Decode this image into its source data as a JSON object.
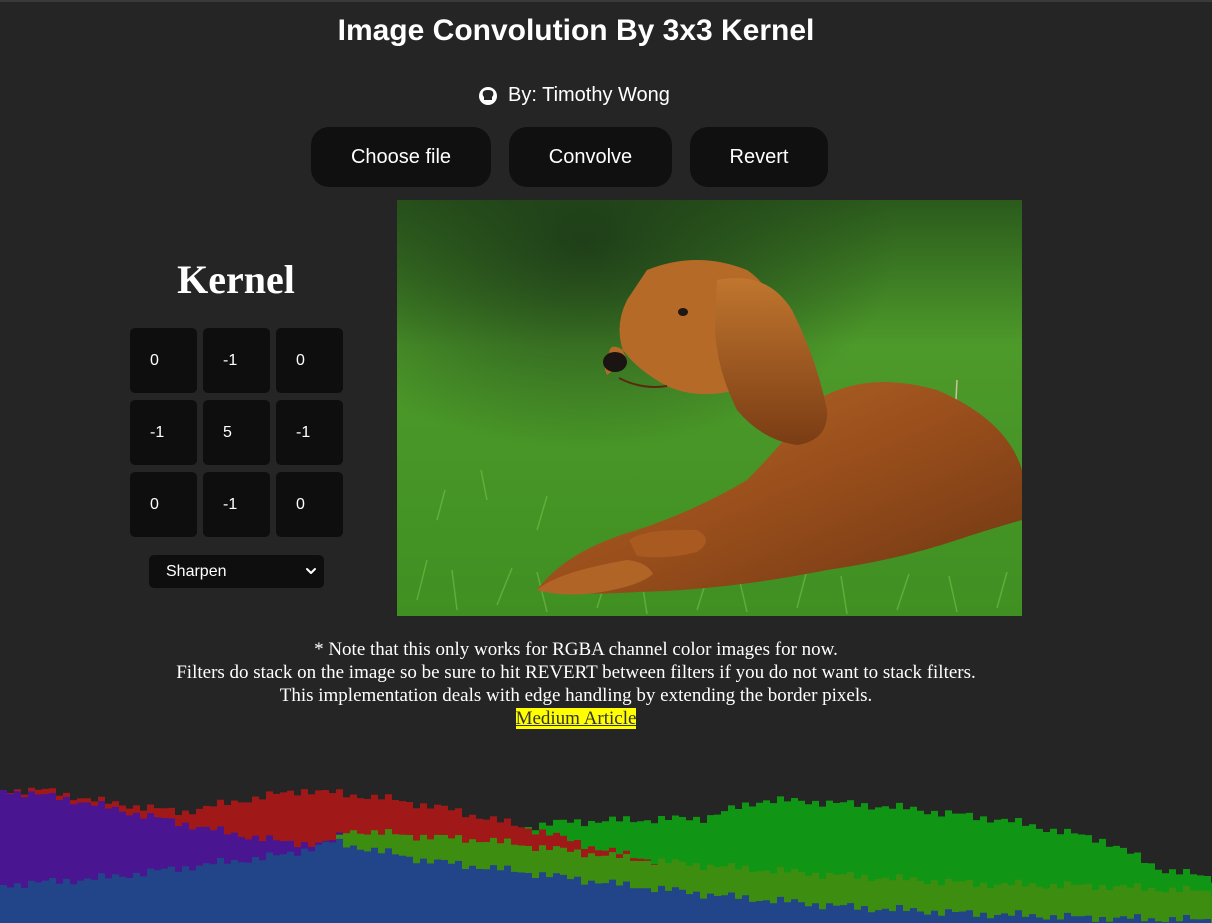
{
  "header": {
    "title": "Image Convolution By 3x3 Kernel",
    "author": "By: Timothy Wong"
  },
  "toolbar": {
    "choose_file_label": "Choose file",
    "convolve_label": "Convolve",
    "revert_label": "Revert"
  },
  "kernel": {
    "title": "Kernel",
    "cells": [
      "0",
      "-1",
      "0",
      "-1",
      "5",
      "-1",
      "0",
      "-1",
      "0"
    ],
    "preset": "Sharpen"
  },
  "notes": {
    "line1": "* Note that this only works for RGBA channel color images for now.",
    "line2": "Filters do stack on the image so be sure to hit REVERT between filters if you do not want to stack filters.",
    "line3": "This implementation deals with edge handling by extending the border pixels.",
    "link_label": "Medium Article"
  },
  "colors": {
    "background": "#252525",
    "button": "#101010",
    "link_highlight": "#ffff00",
    "histogram_red": "#a01818",
    "histogram_green": "#109614",
    "histogram_blue": "#224488"
  },
  "icons": {
    "github": "github-icon",
    "select": "chevron-down-icon"
  }
}
